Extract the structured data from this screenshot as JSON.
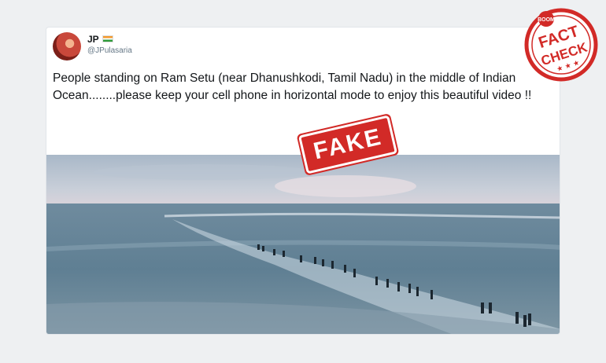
{
  "tweet": {
    "author_name": "JP",
    "author_handle": "@JPulasaria",
    "text": "People standing on Ram Setu (near Dhanushkodi, Tamil Nadu) in the middle of Indian Ocean........please keep your cell phone in horizontal mode to enjoy this beautiful video !!"
  },
  "overlay": {
    "stamp_label": "FAKE",
    "seal_top": "BOOM",
    "seal_line1": "FACT",
    "seal_line2": "CHECK"
  },
  "icons": {
    "flag": "india-flag-icon",
    "menu": "chevron-down-icon"
  },
  "colors": {
    "stamp_red": "#d22a27",
    "handle_gray": "#657786",
    "text": "#14171a"
  }
}
